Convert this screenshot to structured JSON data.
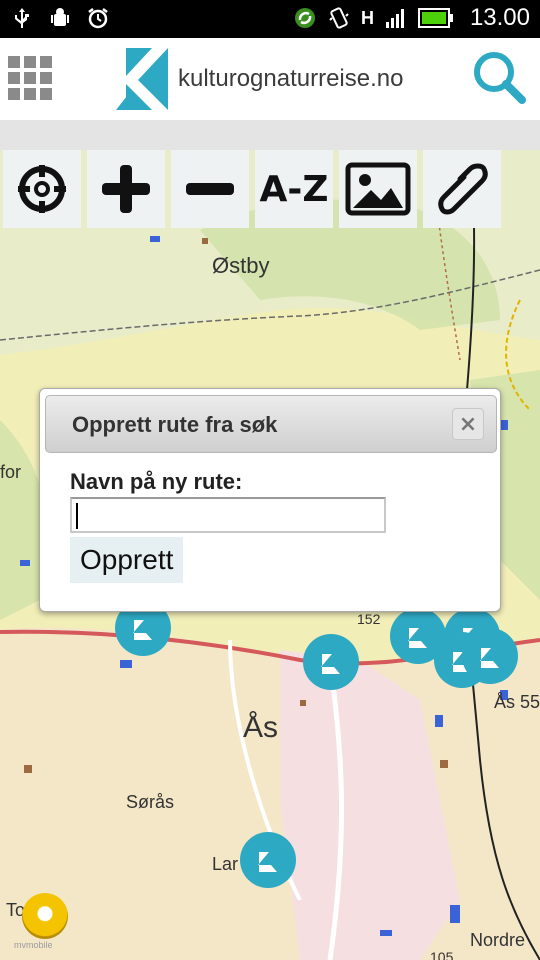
{
  "status_bar": {
    "time": "13.00",
    "network_label": "H",
    "left_icons": [
      "usb-icon",
      "android-debug-icon",
      "alarm-icon"
    ],
    "right_icons": [
      "sync-icon",
      "vibrate-icon",
      "signal-icon",
      "battery-icon"
    ]
  },
  "header": {
    "site_name": "kulturognaturreise.no",
    "brand_color": "#2ea9c4"
  },
  "toolbar": {
    "items": [
      {
        "name": "locate-icon"
      },
      {
        "name": "zoom-in-icon"
      },
      {
        "name": "zoom-out-icon"
      },
      {
        "name": "az-button",
        "label": "A-Z"
      },
      {
        "name": "image-icon"
      },
      {
        "name": "link-icon"
      }
    ]
  },
  "map": {
    "labels": [
      "Østby",
      "Ås",
      "Sørås",
      "Lar",
      "Tor",
      "for",
      "Ås 55",
      "Nordre",
      "152",
      "105"
    ]
  },
  "dialog": {
    "title": "Opprett rute fra søk",
    "field_label": "Navn på ny rute:",
    "input_value": "",
    "button_label": "Opprett",
    "close_label": "×"
  },
  "footer": {
    "avatar_label": "mvmobile"
  }
}
